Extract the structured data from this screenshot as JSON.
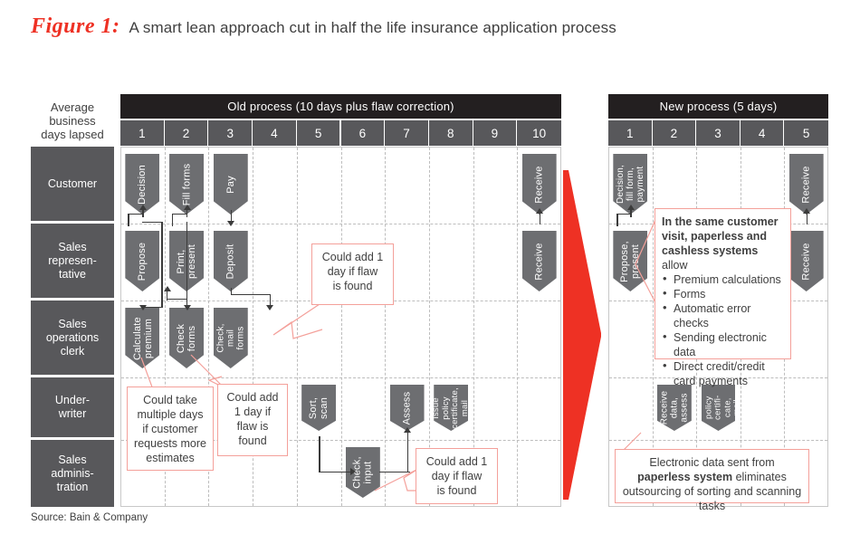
{
  "figure": {
    "label": "Figure 1:",
    "title": "A smart lean approach cut in half the life insurance application process",
    "source": "Source: Bain & Company"
  },
  "colors": {
    "accent_red": "#ee3124",
    "callout_border": "#f4a09a",
    "header_dark": "#231f20",
    "header_gray": "#58585b",
    "shape_gray": "#6d6e71",
    "grid": "#bdbdbd"
  },
  "axis": {
    "left_header": "Average\nbusiness\ndays lapsed",
    "row_labels": [
      "Customer",
      "Sales\nrepresen-\ntative",
      "Sales\noperations\nclerk",
      "Under-\nwriter",
      "Sales\nadminis-\ntration"
    ]
  },
  "sections": [
    {
      "id": "old",
      "header": "Old process (10 days plus flaw correction)",
      "days": [
        "1",
        "2",
        "3",
        "4",
        "5",
        "6",
        "7",
        "8",
        "9",
        "10"
      ]
    },
    {
      "id": "new",
      "header": "New process (5 days)",
      "days": [
        "1",
        "2",
        "3",
        "4",
        "5"
      ]
    }
  ],
  "old_process": {
    "steps": [
      {
        "label": "Decision",
        "row": "Customer",
        "day": 1
      },
      {
        "label": "Fill forms",
        "row": "Customer",
        "day": 2
      },
      {
        "label": "Pay",
        "row": "Customer",
        "day": 3
      },
      {
        "label": "Receive",
        "row": "Customer",
        "day": 10
      },
      {
        "label": "Propose",
        "row": "Sales representative",
        "day": 1
      },
      {
        "label": "Print,\npresent",
        "row": "Sales representative",
        "day": 2
      },
      {
        "label": "Deposit",
        "row": "Sales representative",
        "day": 3
      },
      {
        "label": "Receive",
        "row": "Sales representative",
        "day": 10
      },
      {
        "label": "Calculate\npremium",
        "row": "Sales operations clerk",
        "day": 1
      },
      {
        "label": "Check\nforms",
        "row": "Sales operations clerk",
        "day": 2
      },
      {
        "label": "Check,\nmail\nforms",
        "row": "Sales operations clerk",
        "day": 3
      },
      {
        "label": "Sort,\nscan",
        "row": "Underwriter",
        "day": 5
      },
      {
        "label": "Assess",
        "row": "Underwriter",
        "day": 7
      },
      {
        "label": "Issue\npolicy\ncertificate,\nmail",
        "row": "Underwriter",
        "day": 8
      },
      {
        "label": "Check,\ninput",
        "row": "Sales administration",
        "day": 6
      }
    ],
    "callouts": [
      {
        "id": "old-callout-1",
        "text": "Could add 1\nday if flaw\nis found"
      },
      {
        "id": "old-callout-2",
        "text": "Could take\nmultiple days\nif customer\nrequests more\nestimates"
      },
      {
        "id": "old-callout-3",
        "text": "Could add\n1 day if\nflaw is\nfound"
      },
      {
        "id": "old-callout-4",
        "text": "Could add 1\nday if flaw\nis found"
      }
    ]
  },
  "new_process": {
    "steps": [
      {
        "label": "Decision,\nfill form,\npayment",
        "row": "Customer",
        "day": 1
      },
      {
        "label": "Receive",
        "row": "Customer",
        "day": 5
      },
      {
        "label": "Propose,\npresent",
        "row": "Sales representative",
        "day": 1
      },
      {
        "label": "Receive",
        "row": "Sales representative",
        "day": 5
      },
      {
        "label": "Receive\ndata,\nassess",
        "row": "Underwriter",
        "day": 2
      },
      {
        "label": "Issue\npolicy\ncertifi-\ncate,\nmail",
        "row": "Underwriter",
        "day": 3
      }
    ],
    "callout_main": {
      "lead_bold": "In the same customer visit, paperless and cashless systems",
      "lead_rest": " allow",
      "bullets": [
        "Premium calculations",
        "Forms",
        "Automatic error checks",
        "Sending electronic data",
        "Direct credit/credit card payments"
      ]
    },
    "callout_bottom": {
      "part1": "Electronic data sent from ",
      "bold1": "paperless system",
      "part2": " eliminates outsourcing of sorting and scanning tasks"
    }
  }
}
